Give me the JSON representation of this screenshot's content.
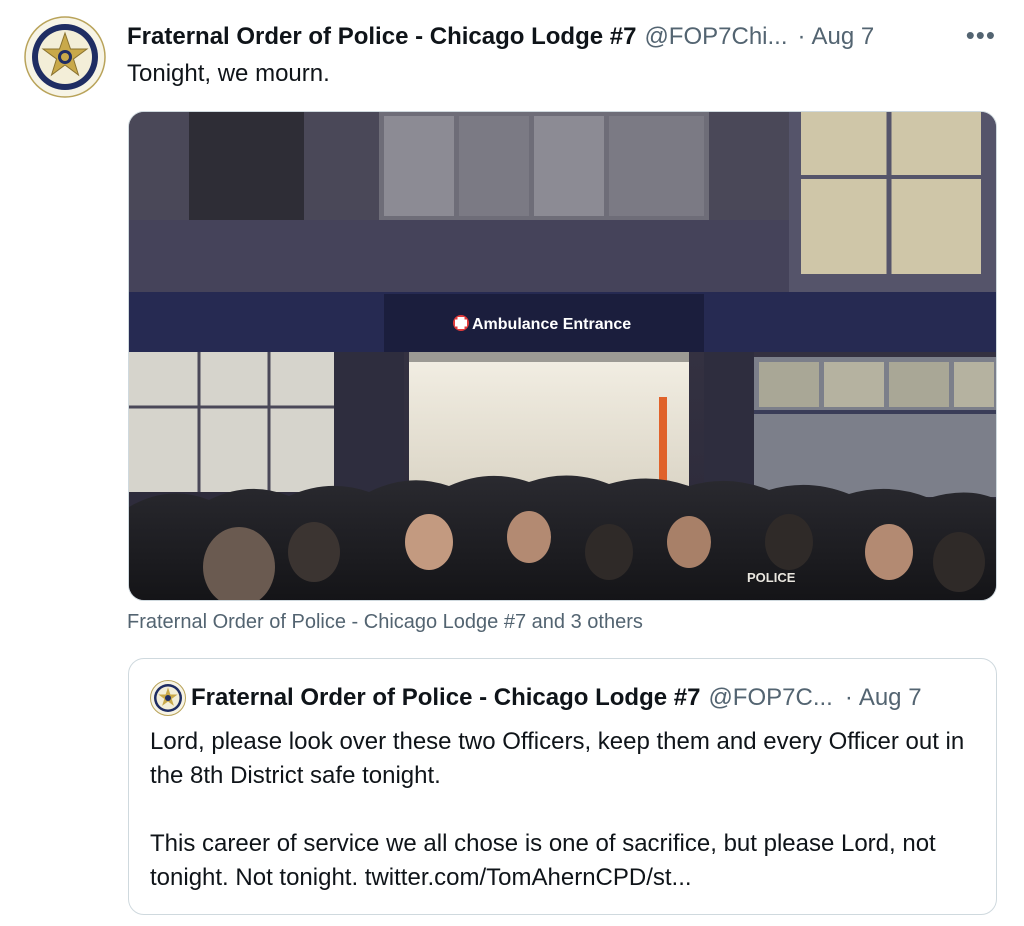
{
  "tweet": {
    "author_name": "Fraternal Order of Police - Chicago Lodge #7",
    "author_handle": "@FOP7Chi...",
    "separator": "·",
    "date": "Aug 7",
    "more_icon": "more-horizontal-icon",
    "more_label": "•••",
    "text": "Tonight, we mourn.",
    "media": {
      "sign_text": "Ambulance Entrance",
      "uniform_text": "POLICE"
    },
    "media_caption": "Fraternal Order of Police - Chicago Lodge #7 and 3 others"
  },
  "quoted_tweet": {
    "author_name": "Fraternal Order of Police - Chicago Lodge #7",
    "author_handle": "@FOP7C...",
    "separator": "·",
    "date": "Aug 7",
    "paragraph_1": "Lord, please look over these two Officers, keep them and every Officer out in the 8th District safe tonight.",
    "paragraph_2": "This career of service we all chose is one of sacrifice, but please Lord, not tonight. Not tonight. twitter.com/TomAhernCPD/st..."
  },
  "colors": {
    "text_primary": "#0f1419",
    "text_secondary": "#536471",
    "border": "#cfd9de",
    "badge_gold": "#c9a94a",
    "badge_navy": "#1f2d63"
  }
}
